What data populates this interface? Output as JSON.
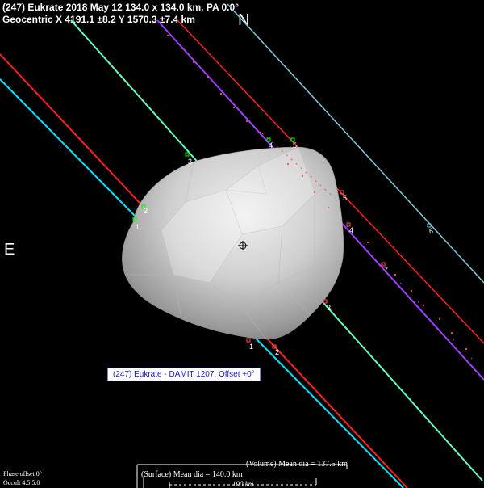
{
  "header": {
    "line1": "(247) Eukrate  2018 May 12  134.0 x 134.0 km, PA 0.0°",
    "line2": "Geocentric  X  4191.1 ±8.2  Y 1570.3 ±7.4 km"
  },
  "compass": {
    "north": "N",
    "east": "E"
  },
  "model_label": "(247) Eukrate - DAMIT 1207: Offset +0°",
  "footer": {
    "phase": "Phase offset 0°",
    "version": "Occult 4.5.5.0",
    "volume": "(Volume) Mean dia = 137.5 km",
    "surface": "(Surface) Mean dia = 140.0 km",
    "scale": "100 km"
  },
  "colors": {
    "red": "#ff2020",
    "cyan": "#00e5ff",
    "green": "#66ffbb",
    "purple": "#a040ff",
    "steel": "#80c8d8",
    "marker_green": "#00ff00",
    "marker_red": "#ff5050"
  },
  "chords": [
    {
      "label": "1",
      "color": "cyan"
    },
    {
      "label": "2",
      "color": "red"
    },
    {
      "label": "3",
      "color": "green"
    },
    {
      "label": "4",
      "color": "purple"
    },
    {
      "label": "5",
      "color": "red"
    },
    {
      "label": "6",
      "color": "steel"
    },
    {
      "label": "7",
      "color": "purple"
    }
  ]
}
